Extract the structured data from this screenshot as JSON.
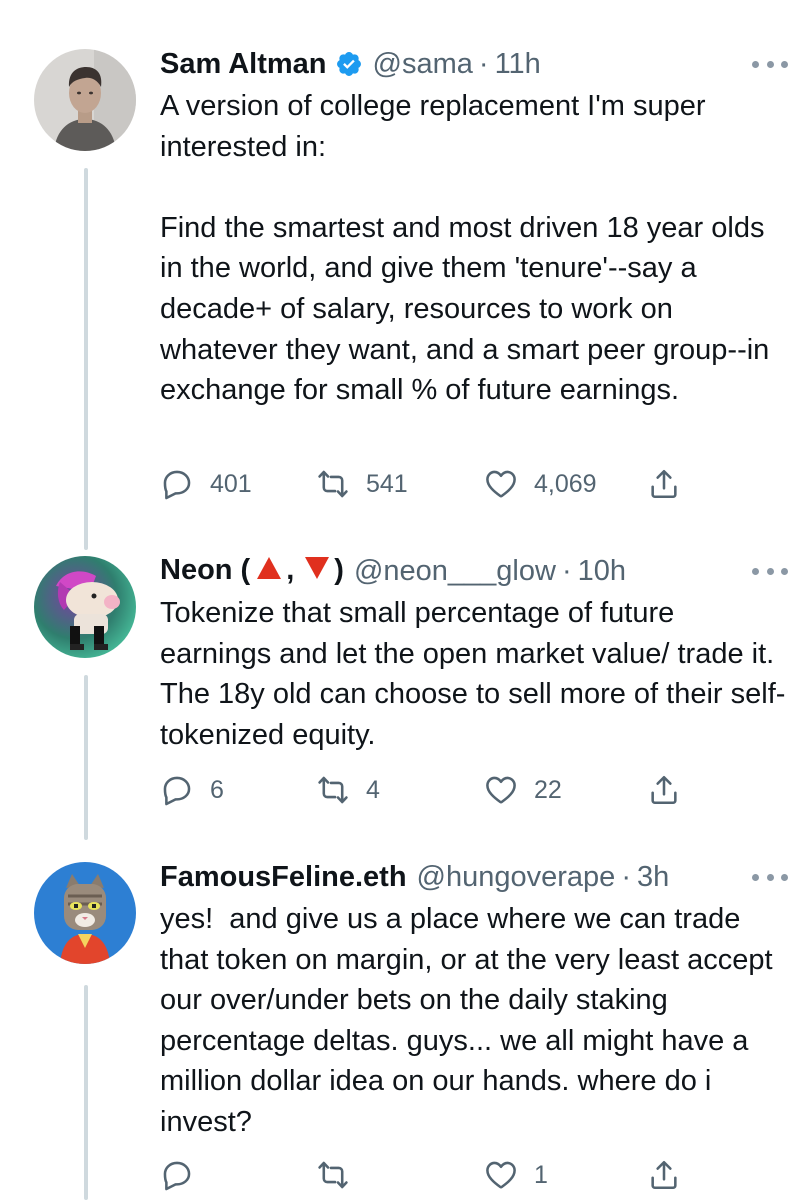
{
  "tweets": [
    {
      "name": "Sam Altman",
      "handle": "@sama",
      "separator": "·",
      "time": "11h",
      "text": "A version of college replacement I'm super interested in:\n\nFind the smartest and most driven 18 year olds in the world, and give them 'tenure'--say a decade+ of salary, resources to work on whatever they want, and a smart peer group--in exchange for small % of future earnings.",
      "reply_count": "401",
      "retweet_count": "541",
      "like_count": "4,069"
    },
    {
      "name": "Neon (",
      "name_sep": ",",
      "name_end": ")",
      "handle": "@neon___glow",
      "separator": "·",
      "time": "10h",
      "text": "Tokenize that small percentage of future earnings and let the open market value/ trade it. The 18y old can choose to sell more of their self-tokenized equity.",
      "reply_count": "6",
      "retweet_count": "4",
      "like_count": "22"
    },
    {
      "name": "FamousFeline.eth",
      "handle": "@hungoverape",
      "separator": "·",
      "time": "3h",
      "text": "yes!  and give us a place where we can trade that token on margin, or at the very least accept our over/under bets on the daily staking percentage deltas. guys... we all might have a million dollar idea on our hands. where do i invest?",
      "reply_count": "",
      "retweet_count": "",
      "like_count": "1"
    }
  ],
  "colors": {
    "verified": "#1d9bf0",
    "muted": "#536471",
    "thread_line": "#cfd9de",
    "red_triangle": "#e0301e"
  },
  "icons": [
    "verified-badge-icon",
    "more-icon",
    "reply-icon",
    "retweet-icon",
    "like-icon",
    "share-icon",
    "red-triangle-up-icon",
    "red-triangle-down-icon"
  ]
}
